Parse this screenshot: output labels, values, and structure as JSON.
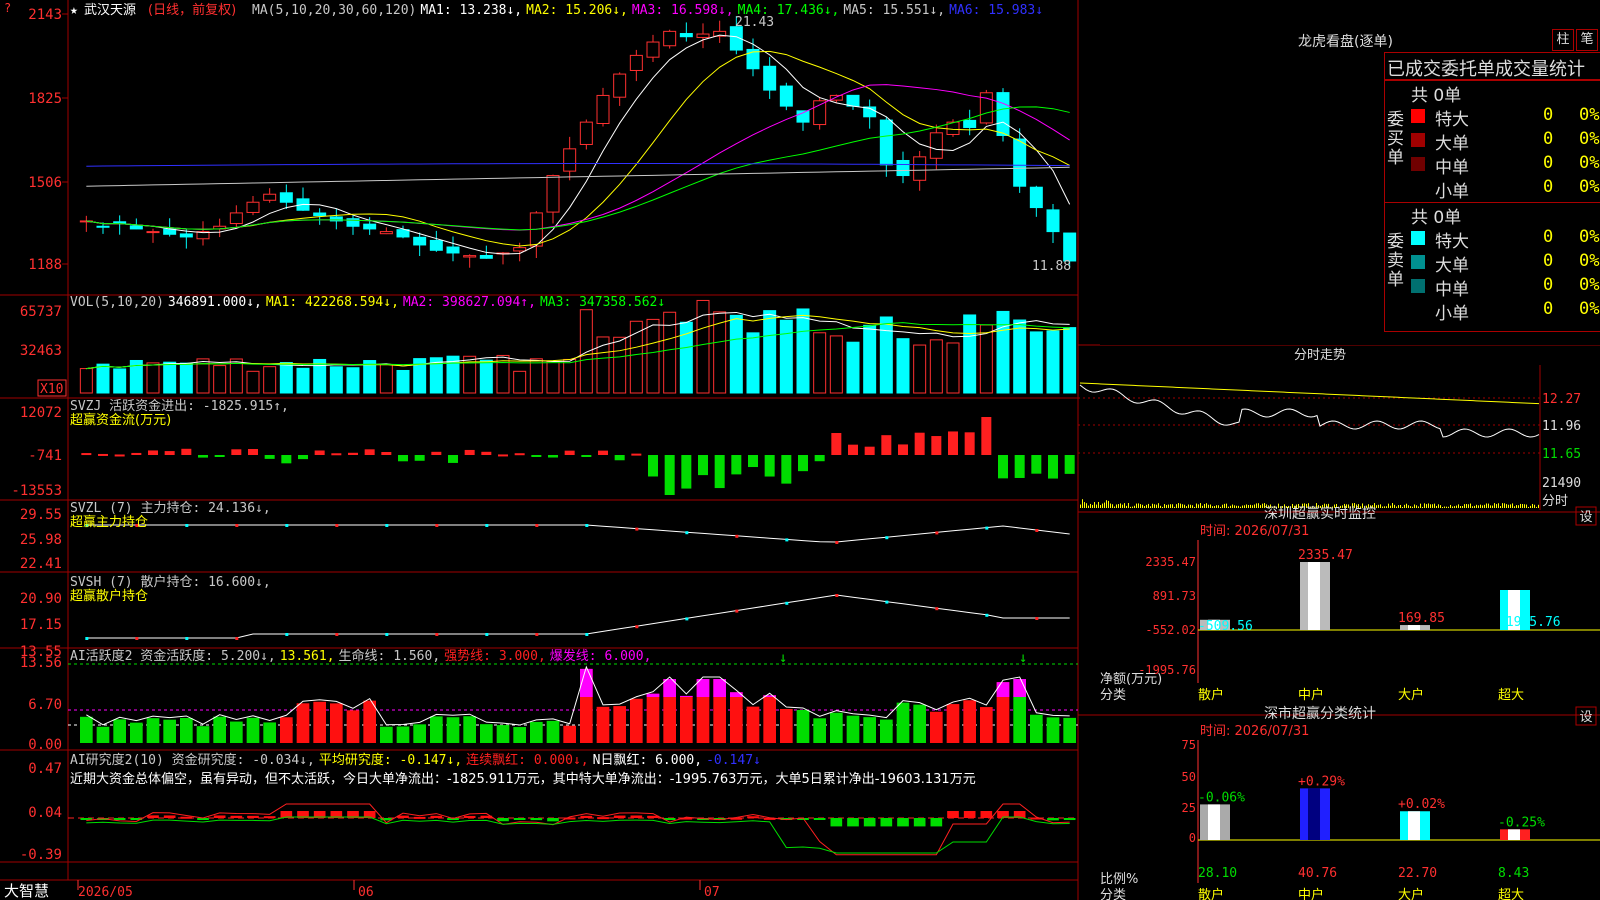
{
  "app": {
    "name": "大智慧",
    "date_labels": [
      "2026/05",
      "06",
      "07"
    ]
  },
  "price_panel": {
    "title": "武汉天源",
    "mode": "(日线，前复权)",
    "legend": [
      {
        "text": "MA(5,10,20,30,60,120)",
        "color": "#c8c8c8"
      },
      {
        "text": "MA1: 13.238↓,",
        "color": "#ffffff"
      },
      {
        "text": "MA2: 15.206↓,",
        "color": "#ffff00"
      },
      {
        "text": "MA3: 16.598↓,",
        "color": "#ff00ff"
      },
      {
        "text": "MA4: 17.436↓,",
        "color": "#00ff00"
      },
      {
        "text": "MA5: 15.551↓,",
        "color": "#c8c8c8"
      },
      {
        "text": "MA6: 15.983↓",
        "color": "#3030ff"
      }
    ],
    "y_ticks": [
      "2143",
      "1825",
      "1506",
      "1188"
    ],
    "high_label": "21.43",
    "low_label": "11.88"
  },
  "vol_panel": {
    "legend": [
      {
        "text": "VOL(5,10,20)",
        "color": "#c8c8c8"
      },
      {
        "text": "346891.000↓,",
        "color": "#ffffff"
      },
      {
        "text": "MA1: 422268.594↓,",
        "color": "#ffff00"
      },
      {
        "text": "MA2: 398627.094↑,",
        "color": "#ff00ff"
      },
      {
        "text": "MA3: 347358.562↓",
        "color": "#00ff00"
      }
    ],
    "y_ticks": [
      "65737",
      "32463"
    ],
    "unit": "X10"
  },
  "svzj_panel": {
    "legend": [
      {
        "text": "SVZJ  活跃资金进出: -1825.915↑,",
        "color": "#c8c8c8"
      }
    ],
    "sub": "超赢资金流(万元)",
    "y_ticks": [
      "12072",
      "-741",
      "-13553"
    ]
  },
  "svzl_panel": {
    "legend": [
      {
        "text": "SVZL (7) 主力持仓: 24.136↓,",
        "color": "#c8c8c8"
      }
    ],
    "sub": "超赢主力持仓",
    "y_ticks": [
      "29.55",
      "25.98",
      "22.41"
    ]
  },
  "svsh_panel": {
    "legend": [
      {
        "text": "SVSH (7) 散户持仓: 16.600↓,",
        "color": "#c8c8c8"
      }
    ],
    "sub": "超赢散户持仓",
    "y_ticks": [
      "20.90",
      "17.15",
      "13.55"
    ]
  },
  "ai_active_panel": {
    "legend": [
      {
        "text": "AI活跃度2 资金活跃度: 5.200↓,",
        "color": "#c8c8c8"
      },
      {
        "text": "13.561,",
        "color": "#ffff00"
      },
      {
        "text": "生命线: 1.560,",
        "color": "#c8c8c8"
      },
      {
        "text": "强势线: 3.000,",
        "color": "#ff2020"
      },
      {
        "text": "爆发线: 6.000,",
        "color": "#ff00ff"
      }
    ],
    "y_ticks": [
      "13.56",
      "6.70",
      "0.00"
    ]
  },
  "ai_research_panel": {
    "legend": [
      {
        "text": "AI研究度2(10) 资金研究度: -0.034↓,",
        "color": "#c8c8c8"
      },
      {
        "text": "平均研究度: -0.147↓,",
        "color": "#ffff00"
      },
      {
        "text": "连续飘红: 0.000↓,",
        "color": "#ff2020"
      },
      {
        "text": "N日飘红: 6.000,",
        "color": "#ffffff"
      },
      {
        "text": "-0.147↓",
        "color": "#3030ff"
      }
    ],
    "comment": "近期大资金总体偏空，虽有异动，但不太活跃，今日大单净流出：-1825.911万元，其中特大单净流出：-1995.763万元，大单5日累计净出-19603.131万元",
    "y_ticks": [
      "0.47",
      "0.04",
      "-0.39"
    ]
  },
  "longhu": {
    "title": "龙虎看盘(逐单)",
    "btn_bar": "柱",
    "btn_stroke": "笔",
    "tabs": [
      "已成交",
      "委托单",
      "成交量统计"
    ],
    "buy_label": "委买单",
    "sell_label": "委卖单",
    "buy_total": "共 0单",
    "sell_total": "共 0单",
    "buy_rows": [
      {
        "label": "特大",
        "count": "0",
        "pct": "0%",
        "color": "#ff0000"
      },
      {
        "label": "大单",
        "count": "0",
        "pct": "0%",
        "color": "#a00000"
      },
      {
        "label": "中单",
        "count": "0",
        "pct": "0%",
        "color": "#700000"
      },
      {
        "label": "小单",
        "count": "0",
        "pct": "0%",
        "color": ""
      }
    ],
    "sell_rows": [
      {
        "label": "特大",
        "count": "0",
        "pct": "0%",
        "color": "#00ffff"
      },
      {
        "label": "大单",
        "count": "0",
        "pct": "0%",
        "color": "#009090"
      },
      {
        "label": "中单",
        "count": "0",
        "pct": "0%",
        "color": "#007070"
      },
      {
        "label": "小单",
        "count": "0",
        "pct": "0%",
        "color": ""
      }
    ]
  },
  "intraday": {
    "title": "分时走势",
    "y_ticks": [
      "12.27",
      "11.96",
      "11.65"
    ],
    "vol_label": "21490",
    "vol_sub": "分时"
  },
  "monitor": {
    "title": "深圳超赢实时监控",
    "set_btn": "设",
    "time": "时间: 2026/07/31",
    "y_ticks": [
      "2335.47",
      "891.73",
      "-552.02",
      "-1995.76"
    ],
    "ylabel": "净额(万元)",
    "xlabel": "分类",
    "bars": [
      {
        "name": "散户",
        "value": -509.56,
        "label": "-509.56"
      },
      {
        "name": "中户",
        "value": 2335.47,
        "label": "2335.47"
      },
      {
        "name": "大户",
        "value": 169.85,
        "label": "169.85"
      },
      {
        "name": "超大",
        "value": -1995.76,
        "label": "-1995.76"
      }
    ]
  },
  "classify": {
    "title": "深市超赢分类统计",
    "set_btn": "设",
    "time": "时间: 2026/07/31",
    "y_ticks": [
      "75",
      "50",
      "25",
      "0"
    ],
    "ylabel": "比例%",
    "xlabel": "分类",
    "bars": [
      {
        "name": "散户",
        "value": 28.1,
        "label": "28.10",
        "change": "-0.06%"
      },
      {
        "name": "中户",
        "value": 40.76,
        "label": "40.76",
        "change": "+0.29%"
      },
      {
        "name": "大户",
        "value": 22.7,
        "label": "22.70",
        "change": "+0.02%"
      },
      {
        "name": "超大",
        "value": 8.43,
        "label": "8.43",
        "change": "-0.25%"
      }
    ]
  }
}
